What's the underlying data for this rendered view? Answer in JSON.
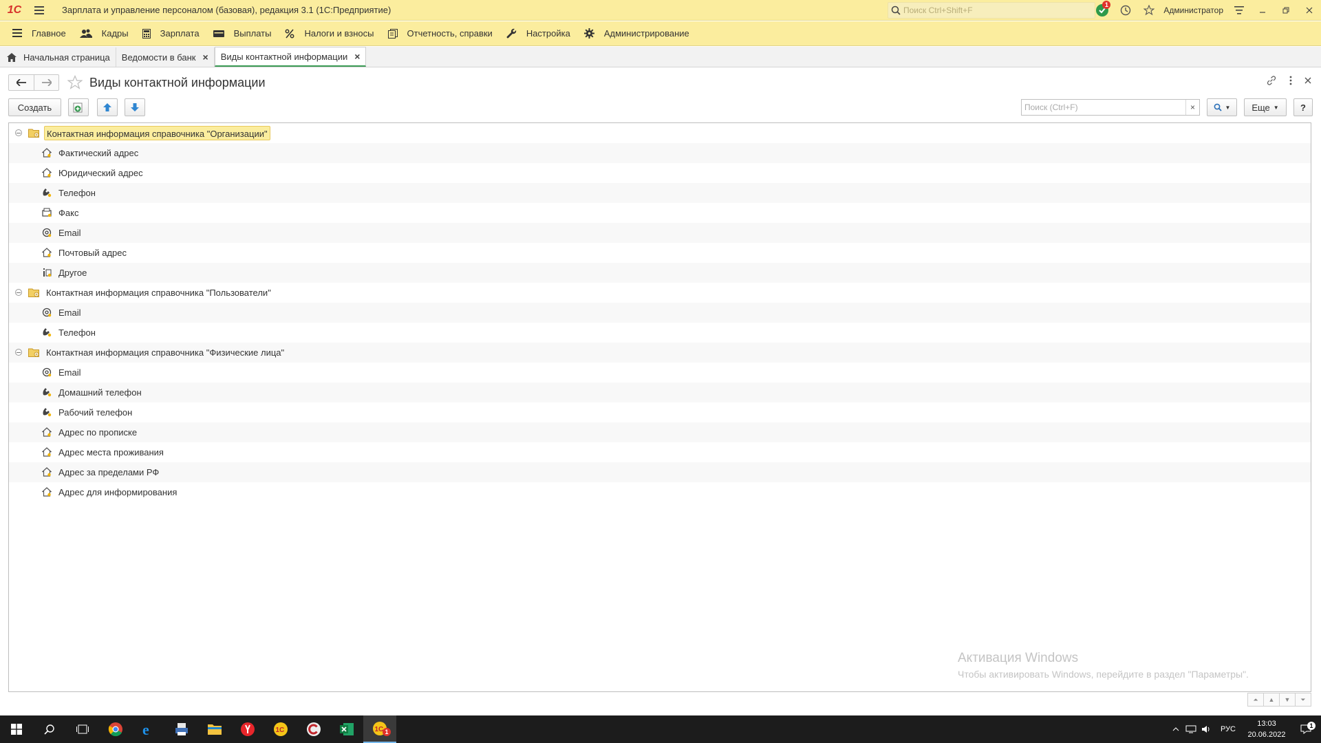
{
  "titlebar": {
    "logo": "1С",
    "title": "Зарплата и управление персоналом (базовая), редакция 3.1  (1С:Предприятие)",
    "search_placeholder": "Поиск Ctrl+Shift+F",
    "notifications_count": "1",
    "user": "Администратор"
  },
  "sections": [
    {
      "label": "Главное",
      "icon": "menu-icon"
    },
    {
      "label": "Кадры",
      "icon": "people-icon"
    },
    {
      "label": "Зарплата",
      "icon": "calculator-icon"
    },
    {
      "label": "Выплаты",
      "icon": "wallet-icon"
    },
    {
      "label": "Налоги и взносы",
      "icon": "percent-icon"
    },
    {
      "label": "Отчетность, справки",
      "icon": "documents-icon"
    },
    {
      "label": "Настройка",
      "icon": "wrench-icon"
    },
    {
      "label": "Администрирование",
      "icon": "gear-icon"
    }
  ],
  "tabs": {
    "home": "Начальная страница",
    "t1": "Ведомости в банк",
    "t2": "Виды контактной информации",
    "close_glyph": "×"
  },
  "form": {
    "title": "Виды контактной информации",
    "create_label": "Создать",
    "search_placeholder": "Поиск (Ctrl+F)",
    "clear_glyph": "×",
    "more_label": "Еще",
    "help_label": "?"
  },
  "tree": [
    {
      "group": "Контактная информация справочника \"Организации\"",
      "selected": true,
      "items": [
        {
          "label": "Фактический адрес",
          "icon": "address-icon"
        },
        {
          "label": "Юридический адрес",
          "icon": "address-icon"
        },
        {
          "label": "Телефон",
          "icon": "phone-icon"
        },
        {
          "label": "Факс",
          "icon": "fax-icon"
        },
        {
          "label": "Email",
          "icon": "email-icon"
        },
        {
          "label": "Почтовый адрес",
          "icon": "address-icon"
        },
        {
          "label": "Другое",
          "icon": "other-icon"
        }
      ]
    },
    {
      "group": "Контактная информация справочника \"Пользователи\"",
      "selected": false,
      "items": [
        {
          "label": "Email",
          "icon": "email-icon"
        },
        {
          "label": "Телефон",
          "icon": "phone-icon"
        }
      ]
    },
    {
      "group": "Контактная информация справочника \"Физические лица\"",
      "selected": false,
      "items": [
        {
          "label": "Email",
          "icon": "email-icon"
        },
        {
          "label": "Домашний телефон",
          "icon": "phone-icon"
        },
        {
          "label": "Рабочий телефон",
          "icon": "phone-icon"
        },
        {
          "label": "Адрес по прописке",
          "icon": "address-icon"
        },
        {
          "label": "Адрес места проживания",
          "icon": "address-icon"
        },
        {
          "label": "Адрес за пределами РФ",
          "icon": "address-icon"
        },
        {
          "label": "Адрес для информирования",
          "icon": "address-icon"
        }
      ]
    }
  ],
  "watermark": {
    "line1": "Активация Windows",
    "line2": "Чтобы активировать Windows, перейдите в раздел \"Параметры\"."
  },
  "taskbar": {
    "time": "13:03",
    "date": "20.06.2022",
    "lang": "РУС",
    "notification_count": "1",
    "app_badge": "1"
  },
  "colors": {
    "panel": "#fbed9e",
    "accent_green": "#3a9b54",
    "selection": "#fbed9e"
  }
}
